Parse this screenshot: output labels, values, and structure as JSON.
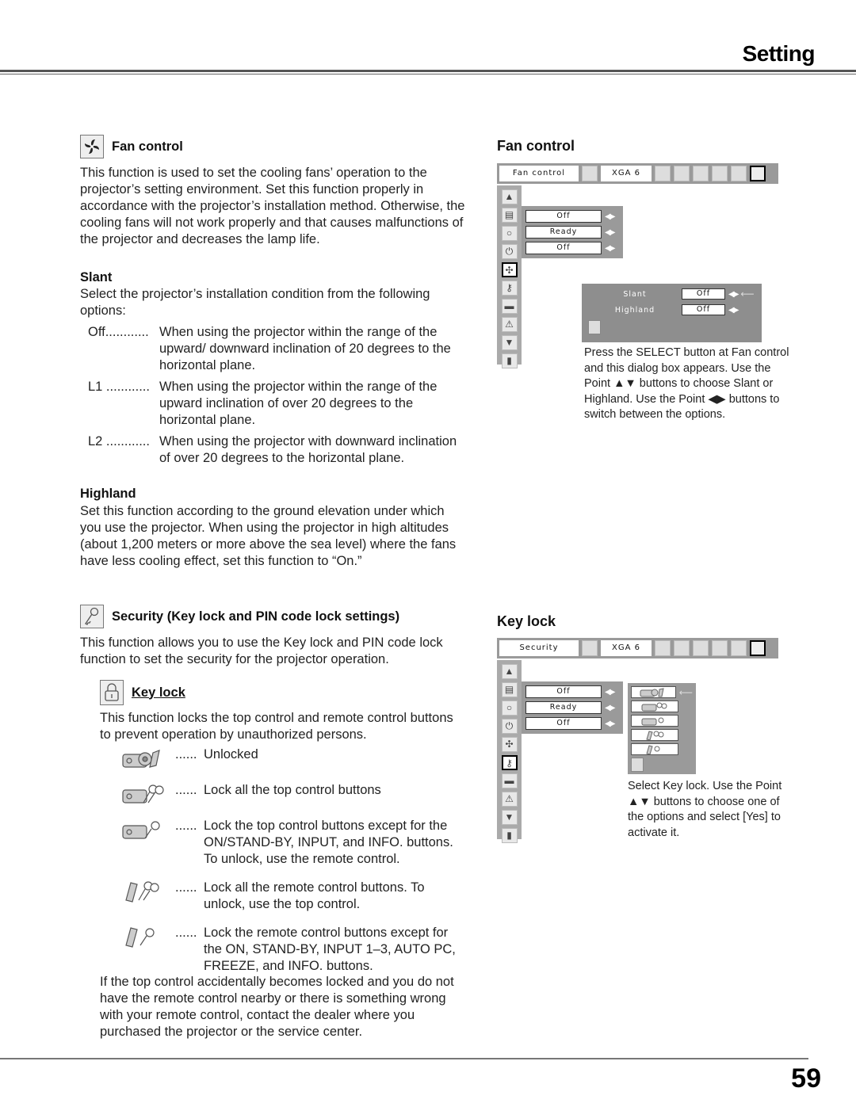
{
  "header": {
    "title": "Setting"
  },
  "footer": {
    "page_number": "59"
  },
  "left": {
    "fan": {
      "icon": "fan-icon",
      "heading": "Fan control",
      "intro": "This function is used to set the cooling fans’ operation to the projector’s setting environment. Set this function properly in accordance with the projector’s installation method. Otherwise, the cooling fans will not work properly and that causes malfunctions of the projector and decreases the lamp life.",
      "slant_heading": "Slant",
      "slant_intro": "Select the projector’s installation condition from the following options:",
      "slant_options": [
        {
          "key": "Off............",
          "desc": "When using the projector within the range of the upward/ downward inclination of 20 degrees to the horizontal plane."
        },
        {
          "key": "L1 ............",
          "desc": "When using the projector within the range of the upward inclination of over 20 degrees to the horizontal plane."
        },
        {
          "key": "L2 ............",
          "desc": "When using the projector with downward inclination of over 20 degrees to the horizontal plane."
        }
      ],
      "highland_heading": "Highland",
      "highland_text": "Set this function according to the ground elevation under which you use the projector. When using the projector in high altitudes (about 1,200 meters or more above the sea level) where the fans have less cooling effect, set this function to “On.”"
    },
    "security": {
      "icon": "key-icon",
      "heading": "Security (Key lock and PIN code lock settings)",
      "intro": "This function allows you to use the Key lock and PIN code lock function to set the security for the projector operation.",
      "keylock_icon": "padlock-icon",
      "keylock_heading": "Key lock",
      "keylock_intro": "This function locks the top control and remote control buttons to prevent operation by unauthorized persons.",
      "options": [
        {
          "icon": "projector-unlocked-icon",
          "dots": "......",
          "desc": "Unlocked"
        },
        {
          "icon": "projector-all-locked-icon",
          "dots": "......",
          "desc": "Lock all the top control buttons"
        },
        {
          "icon": "projector-partial-lock-icon",
          "dots": "......",
          "desc": "Lock the top control buttons except for the ON/STAND-BY, INPUT, and INFO. buttons. To unlock, use the remote control."
        },
        {
          "icon": "remote-all-locked-icon",
          "dots": "......",
          "desc": "Lock all the remote control buttons. To unlock, use the top control."
        },
        {
          "icon": "remote-partial-lock-icon",
          "dots": "......",
          "desc": "Lock the remote control buttons except for the ON, STAND-BY, INPUT 1–3, AUTO PC, FREEZE, and INFO. buttons."
        }
      ],
      "note": "If the top control accidentally becomes locked and you do not have the remote control nearby or there is something wrong with your remote control, contact the dealer where you purchased the projector or the service center."
    }
  },
  "right": {
    "fan_menu": {
      "heading": "Fan control",
      "menu_label": "Fan control",
      "source_label": "XGA 6",
      "fields": [
        "Off",
        "Ready",
        "Off"
      ],
      "dialog": {
        "rows": [
          {
            "label": "Slant",
            "value": "Off"
          },
          {
            "label": "Highland",
            "value": "Off"
          }
        ]
      },
      "caption": "Press the SELECT button at Fan control and this dialog box appears. Use the Point ▲▼ buttons to choose Slant or Highland. Use the Point ◀▶ buttons to switch between the options."
    },
    "keylock_menu": {
      "heading": "Key lock",
      "menu_label": "Security",
      "source_label": "XGA 6",
      "fields": [
        "Off",
        "Ready",
        "Off"
      ],
      "caption": "Select Key lock. Use the Point ▲▼ buttons to choose one of the options and select [Yes] to activate it."
    },
    "side_icons": [
      "up-arrow-icon",
      "display-icon",
      "lamp-icon",
      "power-plug-icon",
      "fan-icon",
      "key-icon",
      "gradient-icon",
      "warning-icon",
      "down-arrow-icon",
      "exit-icon"
    ],
    "top_icons": [
      "computer-input-icon",
      "laptop-icon",
      "color-balls-icon",
      "image-adjust-icon",
      "screen-icon",
      "sound-icon",
      "setting-icon"
    ]
  }
}
